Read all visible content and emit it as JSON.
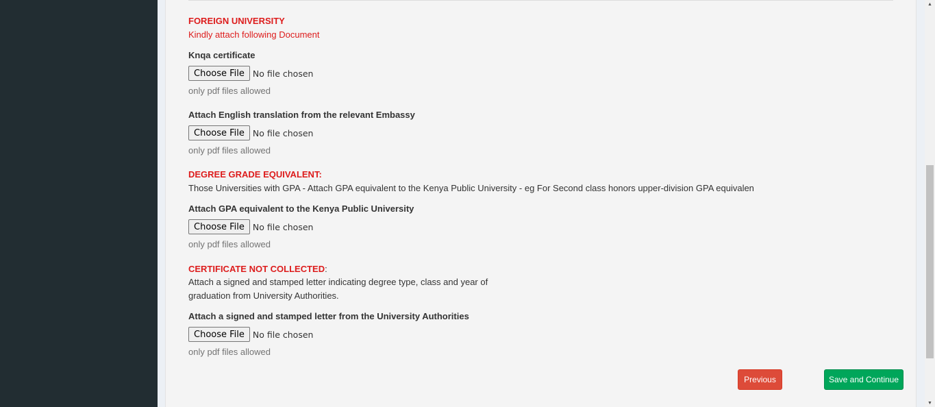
{
  "foreign": {
    "heading": "FOREIGN UNIVERSITY",
    "subheading": "Kindly attach following Document",
    "knqa_label": "Knqa certificate",
    "embassy_label": "Attach English translation from the relevant Embassy"
  },
  "degree": {
    "heading": "DEGREE GRADE EQUIVALENT:",
    "description": "Those Universities with GPA - Attach GPA equivalent to the Kenya Public University - eg For Second class honors upper-division GPA equivalen",
    "gpa_label": "Attach GPA equivalent to the Kenya Public University"
  },
  "not_collected": {
    "heading": "CERTIFICATE NOT COLLECTED",
    "colon": ":",
    "line1": "Attach a signed and stamped letter indicating degree type, class and year of",
    "line2": "graduation from University Authorities.",
    "letter_label": "Attach a signed and stamped letter from the University Authorities"
  },
  "file_input": {
    "button_label": "Choose File",
    "status": "No file chosen",
    "help": "only pdf files allowed"
  },
  "actions": {
    "previous": "Previous",
    "save": "Save and Continue"
  },
  "colors": {
    "sidebar": "#222d32",
    "heading_red": "#dd1c1c",
    "previous": "#dd4b39",
    "save": "#00a65a"
  }
}
